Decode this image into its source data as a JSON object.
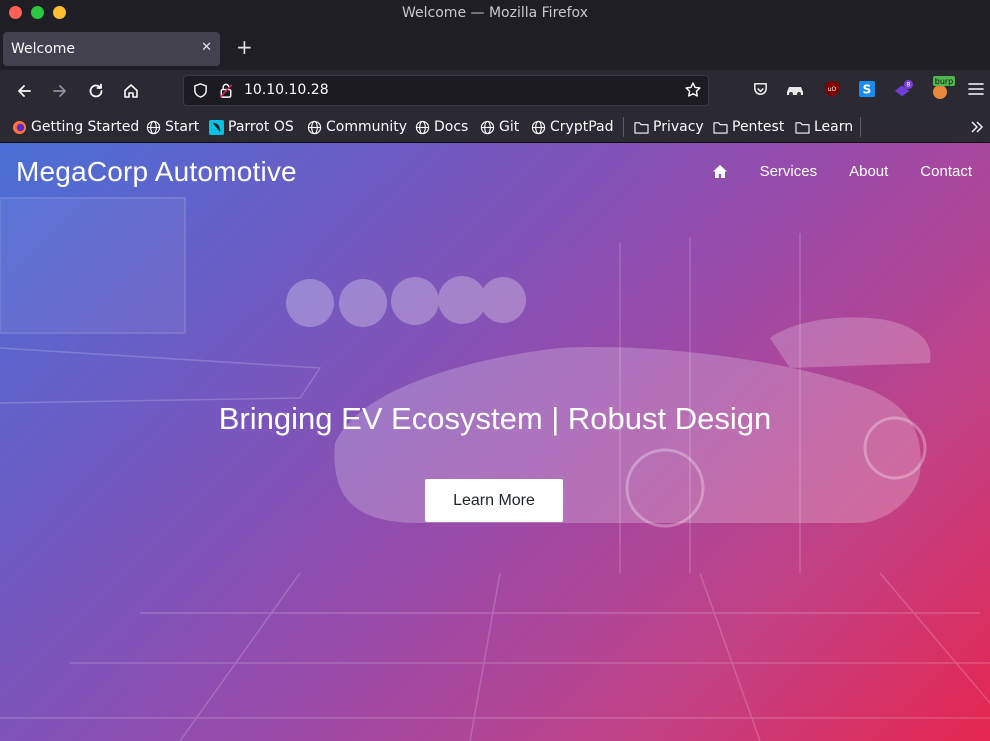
{
  "window": {
    "title": "Welcome — Mozilla Firefox"
  },
  "tab": {
    "title": "Welcome",
    "close_glyph": "✕",
    "new_tab_glyph": "+"
  },
  "navbar": {
    "url": "10.10.10.28"
  },
  "extensions": {
    "badge_count": "8",
    "burp_label": "burp"
  },
  "bookmarks": [
    {
      "label": "Getting Started",
      "icon": "firefox-icon"
    },
    {
      "label": "Start",
      "icon": "globe-icon"
    },
    {
      "label": "Parrot OS",
      "icon": "parrot-icon"
    },
    {
      "label": "Community",
      "icon": "globe-icon"
    },
    {
      "label": "Docs",
      "icon": "globe-icon"
    },
    {
      "label": "Git",
      "icon": "globe-icon"
    },
    {
      "label": "CryptPad",
      "icon": "globe-icon"
    },
    {
      "label": "Privacy",
      "icon": "folder-icon"
    },
    {
      "label": "Pentest",
      "icon": "folder-icon"
    },
    {
      "label": "Learn",
      "icon": "folder-icon"
    }
  ],
  "site": {
    "brand": "MegaCorp Automotive",
    "menu": {
      "services": "Services",
      "about": "About",
      "contact": "Contact"
    },
    "hero_title": "Bringing EV Ecosystem | Robust Design",
    "cta_label": "Learn More"
  },
  "colors": {
    "gradient_start": "#4a6fd6",
    "gradient_end": "#e5264f",
    "browser_chrome": "#2b2a33"
  }
}
